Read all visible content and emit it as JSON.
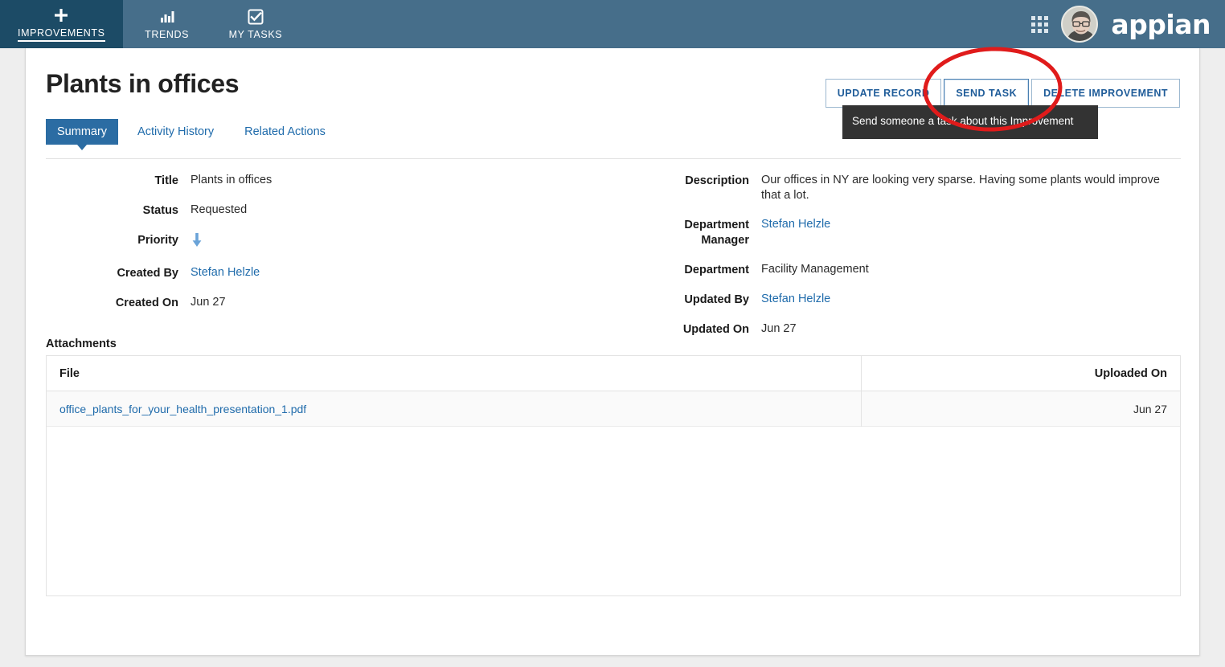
{
  "topnav": {
    "items": [
      {
        "label": "IMPROVEMENTS",
        "icon": "plus-icon",
        "active": true
      },
      {
        "label": "TRENDS",
        "icon": "bar-chart-icon",
        "active": false
      },
      {
        "label": "MY TASKS",
        "icon": "check-square-icon",
        "active": false
      }
    ],
    "grid_icon": "apps-grid-icon",
    "avatar": "user-avatar",
    "brand": "appian",
    "background_color": "#466e8a",
    "active_color": "#1c4b66"
  },
  "record": {
    "title": "Plants in offices",
    "tabs": [
      {
        "label": "Summary",
        "active": true
      },
      {
        "label": "Activity History",
        "active": false
      },
      {
        "label": "Related Actions",
        "active": false
      }
    ],
    "actions": [
      {
        "label": "UPDATE RECORD",
        "hovered": false
      },
      {
        "label": "SEND TASK",
        "hovered": true
      },
      {
        "label": "DELETE IMPROVEMENT",
        "hovered": false
      }
    ],
    "tooltip": "Send someone a task about this Improvement",
    "left_fields": [
      {
        "label": "Title",
        "value": "Plants in offices",
        "type": "text"
      },
      {
        "label": "Status",
        "value": "Requested",
        "type": "text"
      },
      {
        "label": "Priority",
        "value": "",
        "type": "icon",
        "icon": "arrow-down-icon"
      },
      {
        "label": "Created By",
        "value": "Stefan Helzle",
        "type": "link"
      },
      {
        "label": "Created On",
        "value": "Jun 27",
        "type": "text"
      }
    ],
    "right_fields": [
      {
        "label": "Description",
        "value": "Our offices in NY are looking very sparse. Having some plants would improve that a lot.",
        "type": "text"
      },
      {
        "label": "Department Manager",
        "value": "Stefan Helzle",
        "type": "link"
      },
      {
        "label": "Department",
        "value": "Facility Management",
        "type": "text"
      },
      {
        "label": "Updated By",
        "value": "Stefan Helzle",
        "type": "link"
      },
      {
        "label": "Updated On",
        "value": "Jun 27",
        "type": "text"
      }
    ],
    "attachments": {
      "heading": "Attachments",
      "columns": [
        "File",
        "Uploaded On"
      ],
      "rows": [
        {
          "file": "office_plants_for_your_health_presentation_1.pdf",
          "uploaded_on": "Jun 27"
        }
      ]
    }
  },
  "annotation": {
    "shape": "red-ellipse-highlight",
    "color": "#e01b1b",
    "target": "SEND TASK"
  },
  "colors": {
    "accent_blue": "#2b6ca3",
    "link_blue": "#1f6bab",
    "button_blue": "#1f5c99",
    "priority_arrow": "#6aa3d8",
    "annotation_red": "#e01b1b",
    "tooltip_bg": "#333333"
  }
}
